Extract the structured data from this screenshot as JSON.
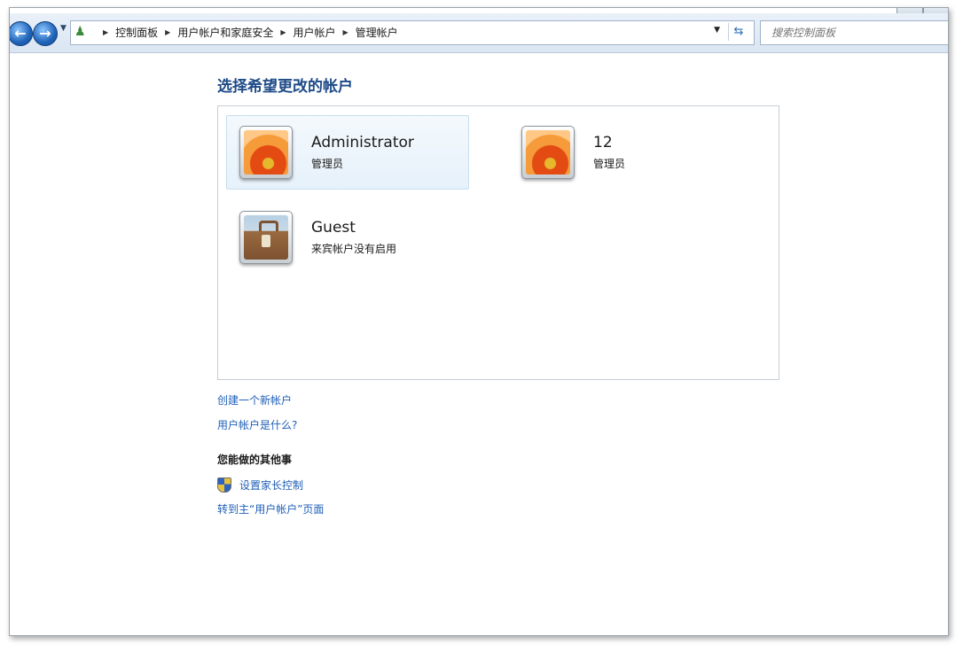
{
  "nav": {
    "back_icon": "back-arrow-icon",
    "forward_icon": "forward-arrow-icon",
    "history_icon": "dropdown-arrow-icon"
  },
  "address_bar": {
    "location_icon": "user-accounts-icon",
    "breadcrumbs": [
      "控制面板",
      "用户帐户和家庭安全",
      "用户帐户",
      "管理帐户"
    ],
    "refresh_icon": "refresh-icon"
  },
  "search": {
    "placeholder": "搜索控制面板"
  },
  "main": {
    "heading": "选择希望更改的帐户",
    "accounts": [
      {
        "name": "Administrator",
        "type": "管理员",
        "picture": "flower-avatar",
        "selected": true
      },
      {
        "name": "12",
        "type": "管理员",
        "picture": "flower-avatar",
        "selected": false
      },
      {
        "name": "Guest",
        "type": "来宾帐户没有启用",
        "picture": "suitcase-avatar",
        "selected": false
      }
    ],
    "links": [
      "创建一个新帐户",
      "用户帐户是什么?"
    ]
  },
  "other_tasks": {
    "title": "您能做的其他事",
    "items": [
      {
        "label": "设置家长控制",
        "icon": "uac-shield-icon"
      },
      {
        "label": "转到主“用户帐户”页面",
        "icon": ""
      }
    ]
  },
  "colors": {
    "link": "#1f5fb7",
    "heading": "#1e4b87",
    "selected_bg": "#e6f1fa"
  }
}
